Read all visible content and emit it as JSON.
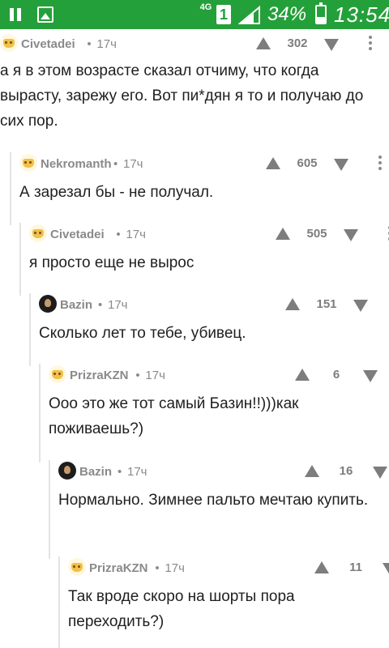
{
  "status_bar": {
    "network": "4G",
    "sim": "1",
    "battery_percent": "34%",
    "battery_level": 0.34,
    "time": "13:54",
    "icons": [
      "pause-icon",
      "image-icon",
      "signal-icon",
      "battery-icon"
    ]
  },
  "comments": [
    {
      "author": "Civetadei",
      "time": "17ч",
      "rating": "302",
      "avatar": "cat",
      "text": "а я в этом возрасте сказал отчиму, что когда вырасту, зарежу его. Вот пи*дян я то и получаю до сих пор."
    },
    {
      "author": "Nekromanth",
      "time": "17ч",
      "rating": "605",
      "avatar": "cat",
      "text": "А зарезал бы - не получал."
    },
    {
      "author": "Civetadei",
      "time": "17ч",
      "rating": "505",
      "avatar": "cat",
      "text": "я просто еще не вырос"
    },
    {
      "author": "Bazin",
      "time": "17ч",
      "rating": "151",
      "avatar": "dark",
      "text": "Сколько лет то тебе, убивец."
    },
    {
      "author": "PrizraKZN",
      "time": "17ч",
      "rating": "6",
      "avatar": "cat",
      "text": "Ооо это же тот самый Базин!!)))как поживаешь?)"
    },
    {
      "author": "Bazin",
      "time": "17ч",
      "rating": "16",
      "avatar": "dark",
      "text": "Нормально. Зимнее пальто мечтаю купить."
    },
    {
      "author": "PrizraKZN",
      "time": "17ч",
      "rating": "11",
      "avatar": "cat",
      "text": "Так вроде скоро на шорты пора переходить?)"
    }
  ]
}
